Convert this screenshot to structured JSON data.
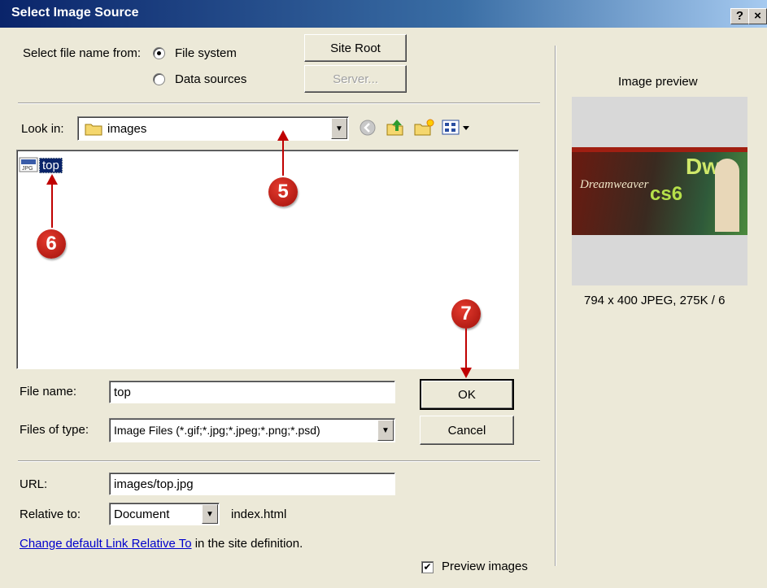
{
  "window": {
    "title": "Select Image Source",
    "help_label": "?",
    "close_label": "×"
  },
  "source": {
    "label": "Select file name from:",
    "options": [
      {
        "label": "File system",
        "selected": true
      },
      {
        "label": "Data sources",
        "selected": false
      }
    ],
    "site_root_label": "Site Root",
    "server_label": "Server..."
  },
  "look_in": {
    "label": "Look in:",
    "value": "images"
  },
  "file_list": [
    {
      "name": "top",
      "type": "jpg-icon",
      "selected": true
    }
  ],
  "file_name": {
    "label": "File name:",
    "value": "top"
  },
  "files_of_type": {
    "label": "Files of type:",
    "value": "Image Files (*.gif;*.jpg;*.jpeg;*.png;*.psd)"
  },
  "buttons": {
    "ok_label": "OK",
    "cancel_label": "Cancel"
  },
  "url": {
    "label": "URL:",
    "value": "images/top.jpg"
  },
  "relative": {
    "label": "Relative to:",
    "value": "Document",
    "page": "index.html"
  },
  "link": {
    "text": "Change default Link Relative To",
    "suffix": "in the site definition."
  },
  "preview_checkbox": {
    "label": "Preview images",
    "checked": true
  },
  "preview": {
    "heading": "Image preview",
    "info": "794 x 400 JPEG, 275K / 6",
    "thumb_title": "Dreamweaver",
    "thumb_badge": "cs6",
    "thumb_logo": "Dw"
  },
  "callouts": {
    "c5": "5",
    "c6": "6",
    "c7": "7"
  },
  "colors": {
    "title_bar": "#0a246a",
    "callout": "#c00000",
    "selection": "#0a246a"
  }
}
